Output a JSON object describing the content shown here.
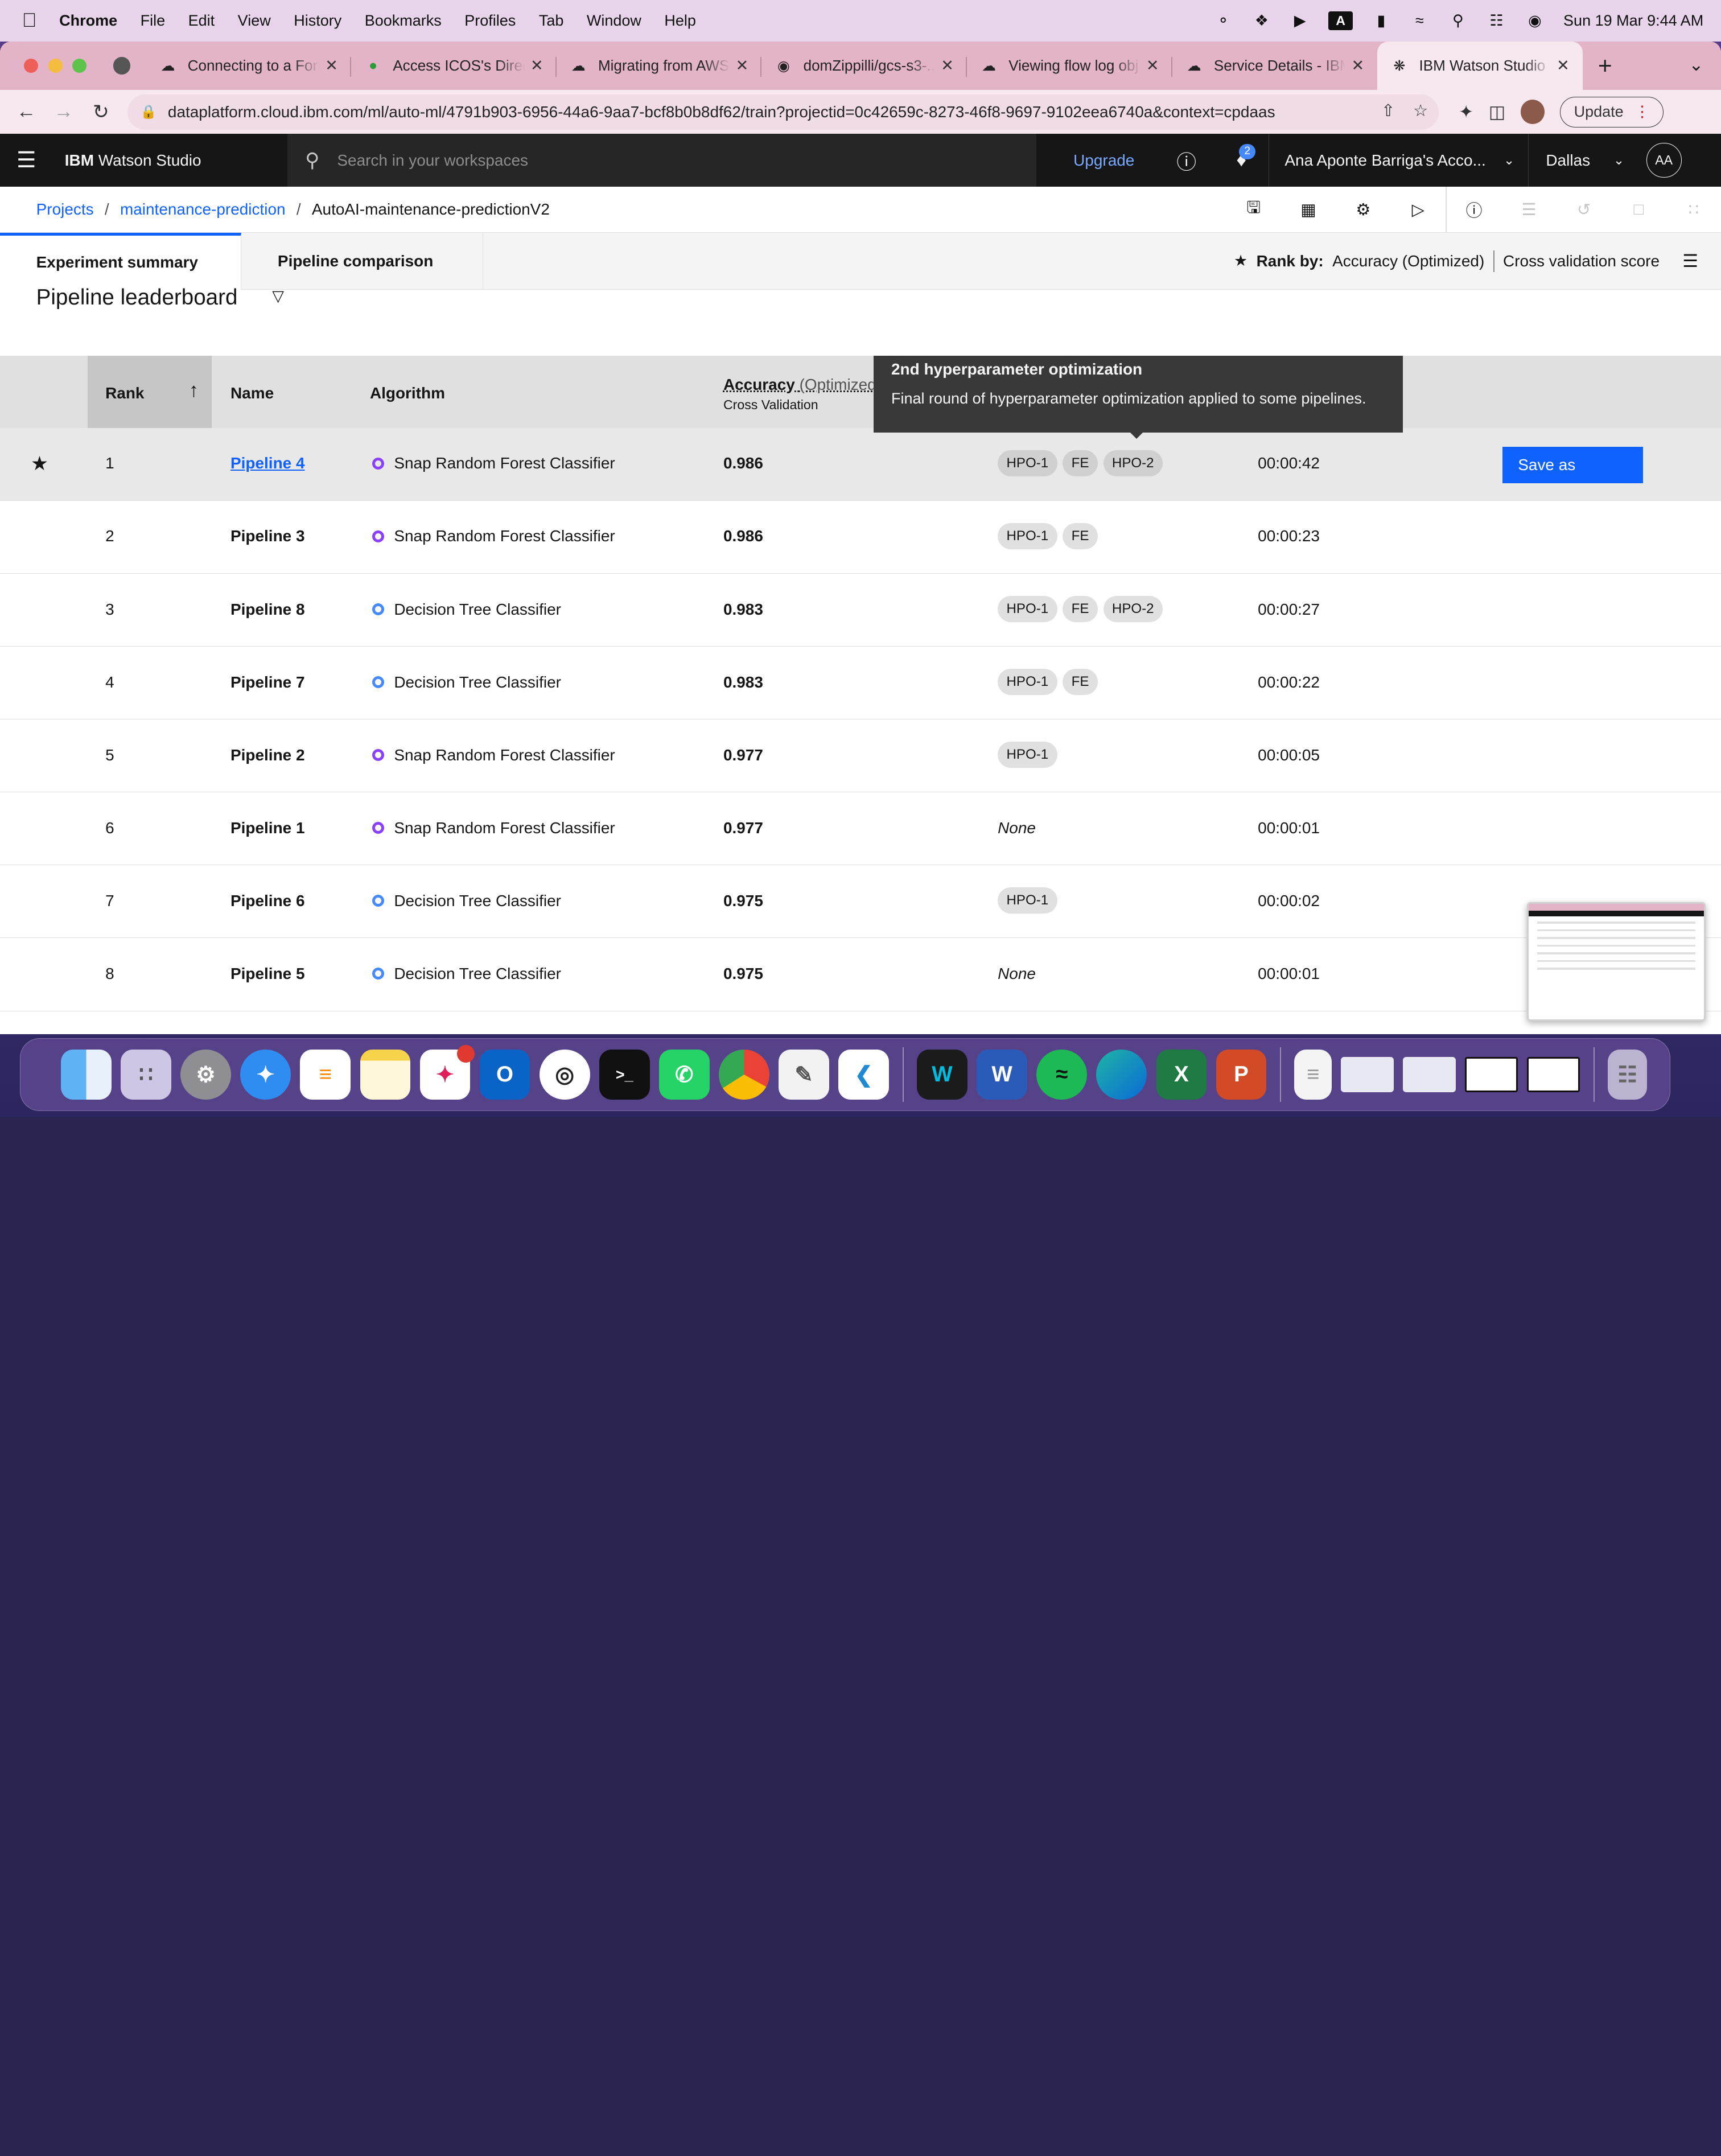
{
  "menubar": {
    "app": "Chrome",
    "items": [
      "File",
      "Edit",
      "View",
      "History",
      "Bookmarks",
      "Profiles",
      "Tab",
      "Window",
      "Help"
    ],
    "clock": "Sun 19 Mar  9:44 AM",
    "input_source": "A"
  },
  "browser": {
    "tabs": [
      {
        "title": "Connecting to a Forti..."
      },
      {
        "title": "Access ICOS's Direct..."
      },
      {
        "title": "Migrating from AWS..."
      },
      {
        "title": "domZippilli/gcs-s3-..."
      },
      {
        "title": "Viewing flow log obj..."
      },
      {
        "title": "Service Details - IBM..."
      },
      {
        "title": "IBM Watson Studio"
      }
    ],
    "url": "dataplatform.cloud.ibm.com/ml/auto-ml/4791b903-6956-44a6-9aa7-bcf8b0b8df62/train?projectid=0c42659c-8273-46f8-9697-9102eea6740a&context=cpdaas",
    "update_label": "Update"
  },
  "header": {
    "brand_prefix": "IBM",
    "brand_name": "Watson Studio",
    "search_placeholder": "Search in your workspaces",
    "upgrade": "Upgrade",
    "notifications": "2",
    "account": "Ana Aponte Barriga's Acco...",
    "region": "Dallas",
    "avatar": "AA"
  },
  "breadcrumb": {
    "projects": "Projects",
    "project": "maintenance-prediction",
    "current": "AutoAI-maintenance-predictionV2"
  },
  "tabs": {
    "summary": "Experiment summary",
    "comparison": "Pipeline comparison",
    "rank_by_label": "Rank by:",
    "rank_metric": "Accuracy (Optimized)",
    "rank_source": "Cross validation score"
  },
  "leaderboard": {
    "title": "Pipeline leaderboard",
    "columns": {
      "rank": "Rank",
      "name": "Name",
      "algorithm": "Algorithm",
      "accuracy": "Accuracy",
      "accuracy_suffix": "(Optimized",
      "cv": "Cross Validation"
    },
    "save_as": "Save as",
    "rows": [
      {
        "rank": "1",
        "name": "Pipeline 4",
        "algorithm": "Snap Random Forest Classifier",
        "accuracy": "0.986",
        "enhancements": [
          "HPO-1",
          "FE",
          "HPO-2"
        ],
        "time": "00:00:42"
      },
      {
        "rank": "2",
        "name": "Pipeline 3",
        "algorithm": "Snap Random Forest Classifier",
        "accuracy": "0.986",
        "enhancements": [
          "HPO-1",
          "FE"
        ],
        "time": "00:00:23"
      },
      {
        "rank": "3",
        "name": "Pipeline 8",
        "algorithm": "Decision Tree Classifier",
        "accuracy": "0.983",
        "enhancements": [
          "HPO-1",
          "FE",
          "HPO-2"
        ],
        "time": "00:00:27"
      },
      {
        "rank": "4",
        "name": "Pipeline 7",
        "algorithm": "Decision Tree Classifier",
        "accuracy": "0.983",
        "enhancements": [
          "HPO-1",
          "FE"
        ],
        "time": "00:00:22"
      },
      {
        "rank": "5",
        "name": "Pipeline 2",
        "algorithm": "Snap Random Forest Classifier",
        "accuracy": "0.977",
        "enhancements": [
          "HPO-1"
        ],
        "time": "00:00:05"
      },
      {
        "rank": "6",
        "name": "Pipeline 1",
        "algorithm": "Snap Random Forest Classifier",
        "accuracy": "0.977",
        "enhancements": [],
        "none_label": "None",
        "time": "00:00:01"
      },
      {
        "rank": "7",
        "name": "Pipeline 6",
        "algorithm": "Decision Tree Classifier",
        "accuracy": "0.975",
        "enhancements": [
          "HPO-1"
        ],
        "time": "00:00:02"
      },
      {
        "rank": "8",
        "name": "Pipeline 5",
        "algorithm": "Decision Tree Classifier",
        "accuracy": "0.975",
        "enhancements": [],
        "none_label": "None",
        "time": "00:00:01"
      }
    ]
  },
  "tooltip": {
    "title": "2nd hyperparameter optimization",
    "body": "Final round of hyperparameter optimization applied to some pipelines."
  },
  "colors": {
    "accent": "#0f62fe",
    "snap_rf_dot": "#8a3ffc",
    "decision_tree_dot": "#4589ff"
  }
}
